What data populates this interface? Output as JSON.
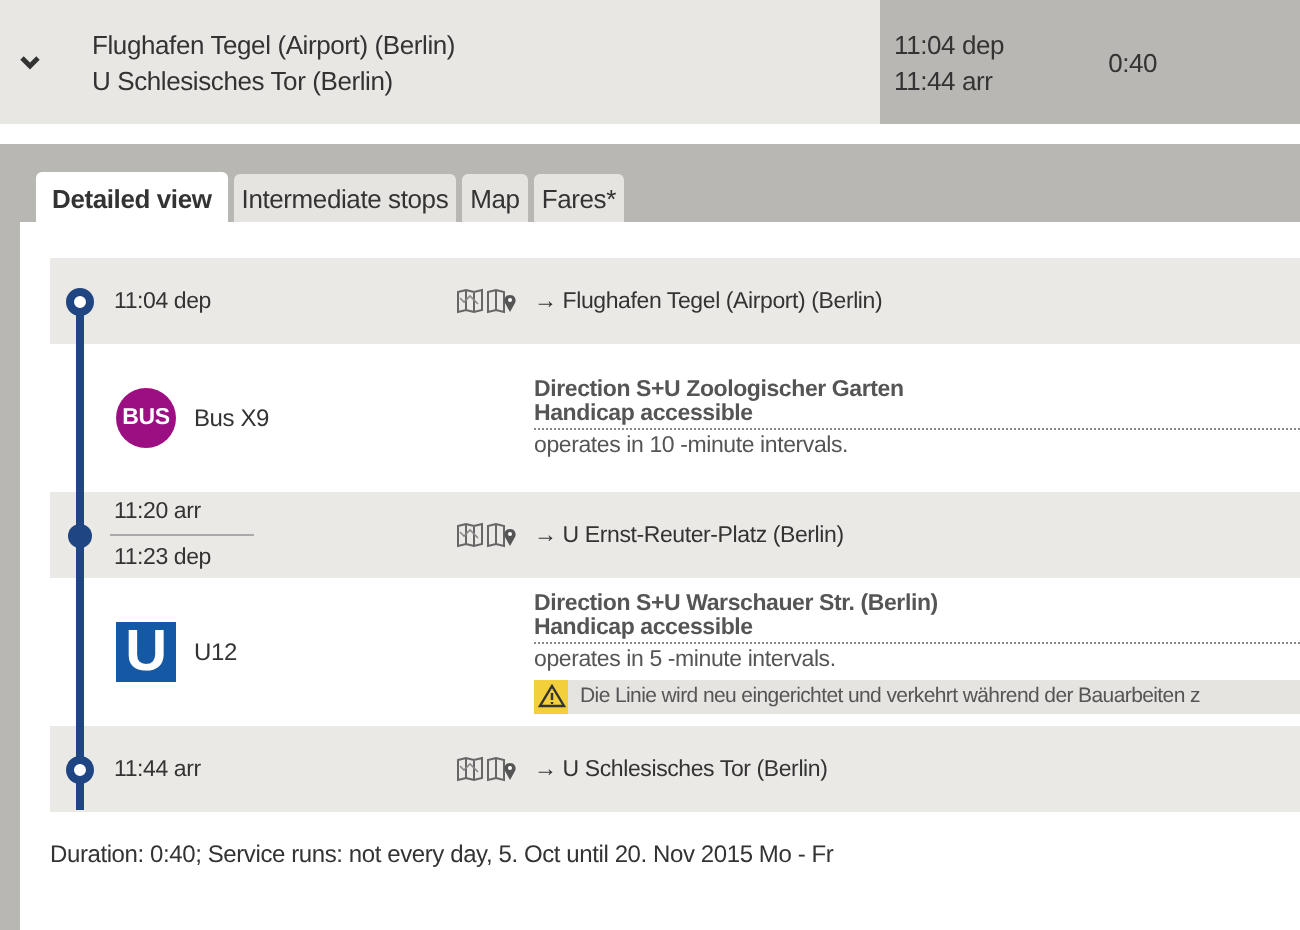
{
  "summary": {
    "from": "Flughafen Tegel (Airport) (Berlin)",
    "to": "U Schlesisches Tor (Berlin)",
    "dep": "11:04 dep",
    "arr": "11:44 arr",
    "duration": "0:40"
  },
  "tabs": [
    {
      "label": "Detailed view",
      "selected": true
    },
    {
      "label": "Intermediate stops",
      "selected": false
    },
    {
      "label": "Map",
      "selected": false
    },
    {
      "label": "Fares*",
      "selected": false
    }
  ],
  "itinerary": [
    {
      "kind": "terminal",
      "times": [
        "11:04 dep"
      ],
      "arrow": "→",
      "name": "Flughafen Tegel (Airport) (Berlin)"
    },
    {
      "kind": "bus",
      "badge": "BUS",
      "line": "Bus X9",
      "direction": "Direction S+U Zoologischer Garten",
      "accessibility": "Handicap accessible",
      "interval": "operates in 10 -minute intervals."
    },
    {
      "kind": "transfer",
      "times": [
        "11:20 arr",
        "11:23 dep"
      ],
      "arrow": "→",
      "name": "U Ernst-Reuter-Platz (Berlin)"
    },
    {
      "kind": "subway",
      "badge": "U",
      "line": "U12",
      "direction": "Direction S+U Warschauer Str. (Berlin)",
      "accessibility": "Handicap accessible",
      "interval": "operates in 5 -minute intervals.",
      "notice": "Die Linie wird neu eingerichtet und verkehrt während der Bauarbeiten z"
    },
    {
      "kind": "terminal",
      "times": [
        "11:44 arr"
      ],
      "arrow": "→",
      "name": "U Schlesisches Tor (Berlin)"
    }
  ],
  "footer": "Duration: 0:40; Service runs: not every day, 5. Oct until 20. Nov 2015 Mo - Fr"
}
